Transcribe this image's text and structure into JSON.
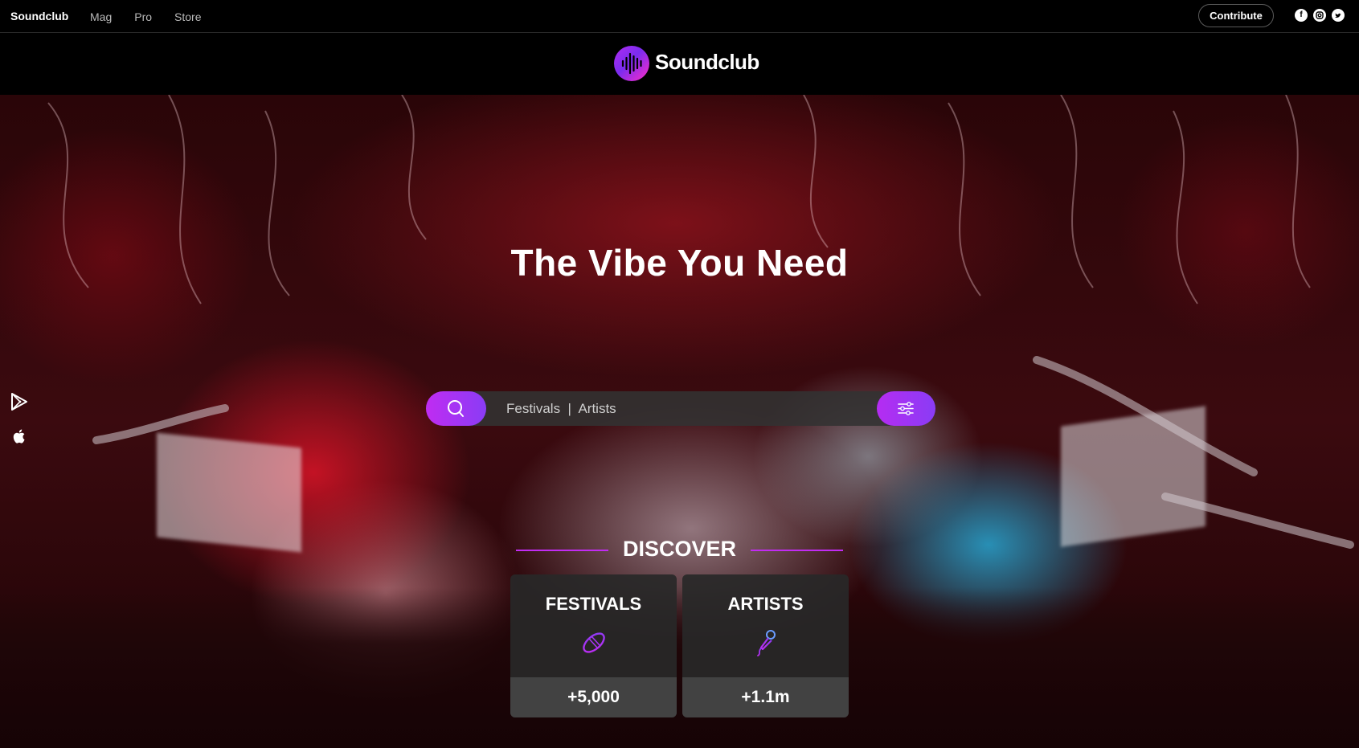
{
  "topnav": {
    "brand": "Soundclub",
    "links": [
      "Mag",
      "Pro",
      "Store"
    ],
    "contribute_label": "Contribute",
    "social_icons": [
      "facebook-icon",
      "instagram-icon",
      "twitter-icon"
    ]
  },
  "header": {
    "logo_text": "Soundclub"
  },
  "hero": {
    "title": "The Vibe You Need",
    "search": {
      "placeholder": "Festivals  |  Artists"
    },
    "side_icons": [
      "google-play-icon",
      "apple-icon"
    ]
  },
  "discover": {
    "heading": "DISCOVER",
    "cards": [
      {
        "title": "FESTIVALS",
        "icon": "wristband-icon",
        "count": "+5,000"
      },
      {
        "title": "ARTISTS",
        "icon": "microphone-icon",
        "count": "+1.1m"
      }
    ]
  },
  "colors": {
    "accent": "#c12cf2",
    "accent_alt": "#8a3cf5",
    "nav_bg": "#000000",
    "card_bg": "#282828"
  }
}
